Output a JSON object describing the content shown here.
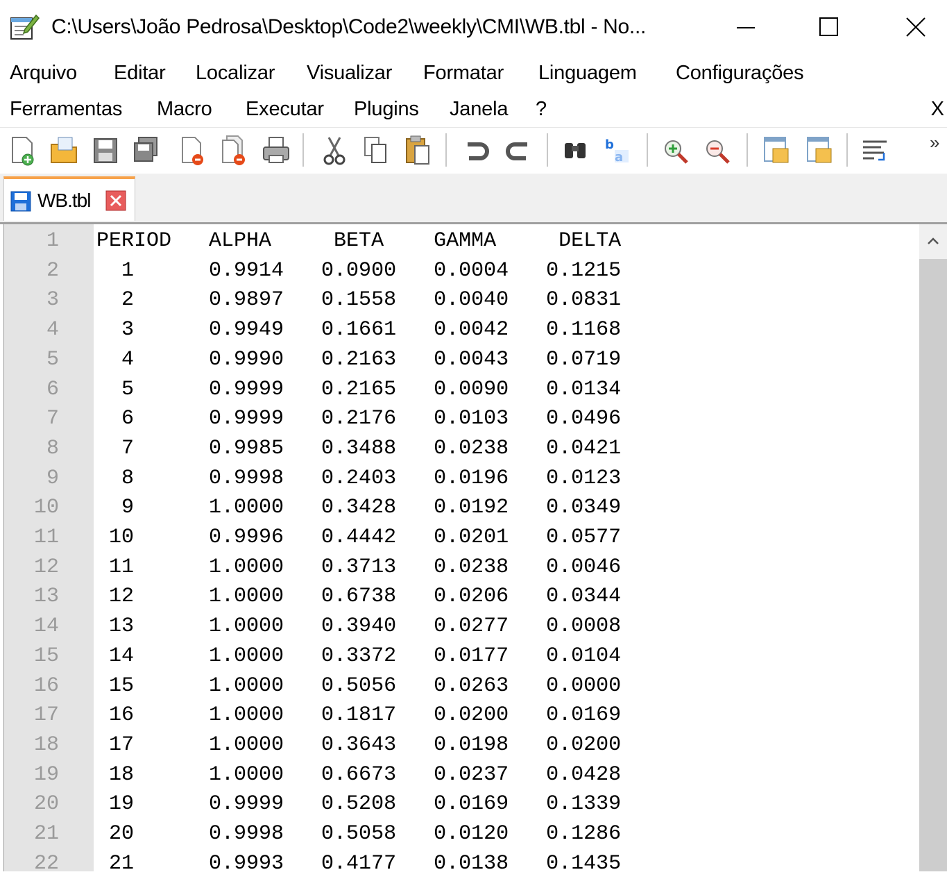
{
  "window": {
    "title": "C:\\Users\\João Pedrosa\\Desktop\\Code2\\weekly\\CMI\\WB.tbl - No..."
  },
  "menu": {
    "row1": [
      "Arquivo",
      "Editar",
      "Localizar",
      "Visualizar",
      "Formatar",
      "Linguagem",
      "Configurações"
    ],
    "row2": [
      "Ferramentas",
      "Macro",
      "Executar",
      "Plugins",
      "Janela",
      "?"
    ],
    "close_label": "X"
  },
  "toolbar": {
    "icons": [
      "new-file-icon",
      "open-file-icon",
      "save-icon",
      "save-all-icon",
      "close-icon",
      "close-all-icon",
      "print-icon",
      "cut-icon",
      "copy-icon",
      "paste-icon",
      "undo-icon",
      "redo-icon",
      "find-icon",
      "replace-icon",
      "zoom-in-icon",
      "zoom-out-icon",
      "sync-vertical-icon",
      "sync-horizontal-icon",
      "word-wrap-icon"
    ],
    "overflow": "»"
  },
  "tab": {
    "label": "WB.tbl"
  },
  "editor": {
    "line_numbers": [
      "1",
      "2",
      "3",
      "4",
      "5",
      "6",
      "7",
      "8",
      "9",
      "10",
      "11",
      "12",
      "13",
      "14",
      "15",
      "16",
      "17",
      "18",
      "19",
      "20",
      "21",
      "22"
    ],
    "lines": [
      "PERIOD   ALPHA     BETA    GAMMA     DELTA",
      "  1      0.9914   0.0900   0.0004   0.1215",
      "  2      0.9897   0.1558   0.0040   0.0831",
      "  3      0.9949   0.1661   0.0042   0.1168",
      "  4      0.9990   0.2163   0.0043   0.0719",
      "  5      0.9999   0.2165   0.0090   0.0134",
      "  6      0.9999   0.2176   0.0103   0.0496",
      "  7      0.9985   0.3488   0.0238   0.0421",
      "  8      0.9998   0.2403   0.0196   0.0123",
      "  9      1.0000   0.3428   0.0192   0.0349",
      " 10      0.9996   0.4442   0.0201   0.0577",
      " 11      1.0000   0.3713   0.0238   0.0046",
      " 12      1.0000   0.6738   0.0206   0.0344",
      " 13      1.0000   0.3940   0.0277   0.0008",
      " 14      1.0000   0.3372   0.0177   0.0104",
      " 15      1.0000   0.5056   0.0263   0.0000",
      " 16      1.0000   0.1817   0.0200   0.0169",
      " 17      1.0000   0.3643   0.0198   0.0200",
      " 18      1.0000   0.6673   0.0237   0.0428",
      " 19      0.9999   0.5208   0.0169   0.1339",
      " 20      0.9998   0.5058   0.0120   0.1286",
      " 21      0.9993   0.4177   0.0138   0.1435"
    ]
  },
  "colors": {
    "tab_accent": "#f7a24a",
    "gutter": "#e4e4e4",
    "scrollbar_thumb": "#cdcdcd"
  }
}
